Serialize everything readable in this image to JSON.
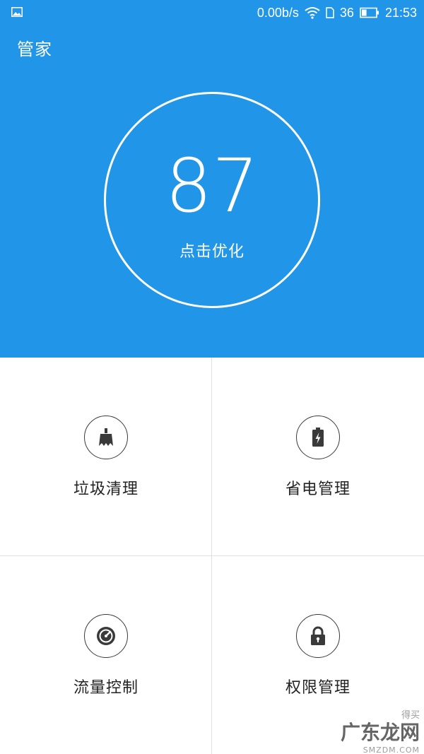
{
  "status_bar": {
    "network_speed": "0.00b/s",
    "signal": "36",
    "time": "21:53",
    "battery_level": 0.35,
    "icons": [
      "image-icon",
      "wifi-icon",
      "sim-icon",
      "battery-icon"
    ]
  },
  "header": {
    "title": "管家"
  },
  "score": {
    "value": "87",
    "action": "点击优化"
  },
  "colors": {
    "primary": "#2196e8",
    "text_dark": "#222222",
    "divider": "#e0e0e0"
  },
  "tiles": [
    {
      "label": "垃圾清理",
      "icon": "broom-icon"
    },
    {
      "label": "省电管理",
      "icon": "battery-bolt-icon"
    },
    {
      "label": "流量控制",
      "icon": "gauge-icon"
    },
    {
      "label": "权限管理",
      "icon": "lock-icon"
    }
  ],
  "watermark": {
    "top": "得买",
    "main": "广东龙网",
    "sub": "SMZDM.COM"
  }
}
